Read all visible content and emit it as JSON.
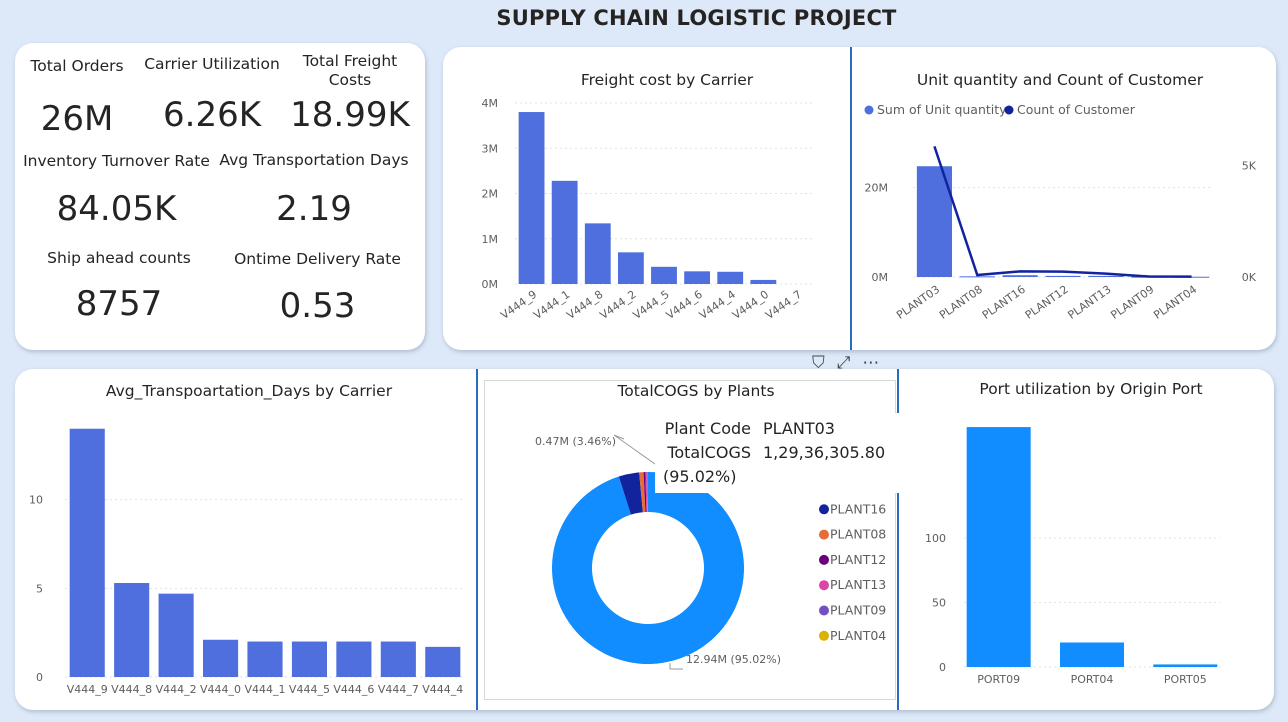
{
  "title": "SUPPLY CHAIN LOGISTIC PROJECT",
  "kpis": {
    "total_orders": {
      "label": "Total Orders",
      "value": "26M"
    },
    "carrier_utilization": {
      "label": "Carrier Utilization",
      "value": "6.26K"
    },
    "total_freight_costs": {
      "label": "Total Freight Costs",
      "value": "18.99K"
    },
    "inventory_turnover": {
      "label": "Inventory Turnover Rate",
      "value": "84.05K"
    },
    "avg_transport_days": {
      "label": "Avg Transportation Days",
      "value": "2.19"
    },
    "ship_ahead": {
      "label": "Ship ahead counts",
      "value": "8757"
    },
    "ontime_delivery": {
      "label": "Ontime Delivery Rate",
      "value": "0.53"
    }
  },
  "colors": {
    "primary_bar": "#4e6fdd",
    "cogs_blue": "#118dff",
    "dark_navy": "#12239e",
    "separator": "#2a6bc2"
  },
  "icons": [
    "filter-icon",
    "focus-mode-icon",
    "more-options-icon"
  ],
  "tooltip": {
    "label1": "Plant Code",
    "value1": "PLANT03",
    "label2": "TotalCOGS",
    "value2": "1,29,36,305.80 (95.02%)"
  },
  "chart_data": [
    {
      "type": "bar",
      "title": "Freight cost by Carrier",
      "categories": [
        "V444_9",
        "V444_1",
        "V444_8",
        "V444_2",
        "V444_5",
        "V444_6",
        "V444_4",
        "V444_0",
        "V444_7"
      ],
      "values": [
        3800000,
        2280000,
        1340000,
        700000,
        380000,
        280000,
        270000,
        90000,
        0
      ],
      "yticks": [
        "0M",
        "1M",
        "2M",
        "3M",
        "4M"
      ],
      "ylim": [
        0,
        4000000
      ]
    },
    {
      "type": "bar",
      "title": "Unit quantity and Count of Customer",
      "categories": [
        "PLANT03",
        "PLANT08",
        "PLANT16",
        "PLANT12",
        "PLANT13",
        "PLANT09",
        "PLANT04"
      ],
      "series": [
        {
          "name": "Sum of Unit quantity",
          "values": [
            24800000,
            150000,
            400000,
            250000,
            250000,
            80000,
            60000
          ]
        },
        {
          "name": "Count of Customer",
          "values": [
            5850,
            90,
            250,
            240,
            150,
            20,
            15
          ]
        }
      ],
      "yticks_left": [
        "0M",
        "20M"
      ],
      "yticks_right": [
        "0K",
        "5K"
      ],
      "ylim_left": [
        0,
        30000000
      ],
      "ylim_right": [
        0,
        6000
      ]
    },
    {
      "type": "bar",
      "title": "Avg_Transpoartation_Days by Carrier",
      "categories": [
        "V444_9",
        "V444_8",
        "V444_2",
        "V444_0",
        "V444_1",
        "V444_5",
        "V444_6",
        "V444_7",
        "V444_4"
      ],
      "values": [
        14.0,
        5.3,
        4.7,
        2.1,
        2.0,
        2.0,
        2.0,
        2.0,
        1.7
      ],
      "yticks": [
        "0",
        "5",
        "10"
      ],
      "ylim": [
        0,
        15
      ]
    },
    {
      "type": "pie",
      "title": "TotalCOGS by Plants",
      "labels": [
        "PLANT03",
        "PLANT16",
        "PLANT08",
        "PLANT12",
        "PLANT13",
        "PLANT09",
        "PLANT04"
      ],
      "values": [
        12.94,
        0.47,
        0.1,
        0.04,
        0.03,
        0.02,
        0.01
      ],
      "colors": [
        "#118dff",
        "#12239e",
        "#e66c37",
        "#6b007b",
        "#e044a7",
        "#744ec2",
        "#d9b300"
      ],
      "data_labels": [
        "12.94M (95.02%)",
        "0.47M (3.46%)"
      ]
    },
    {
      "type": "bar",
      "title": "Port utilization by Origin Port",
      "categories": [
        "PORT09",
        "PORT04",
        "PORT05"
      ],
      "values": [
        186,
        19,
        2
      ],
      "yticks": [
        "0",
        "50",
        "100"
      ],
      "ylim": [
        0,
        200
      ]
    }
  ]
}
